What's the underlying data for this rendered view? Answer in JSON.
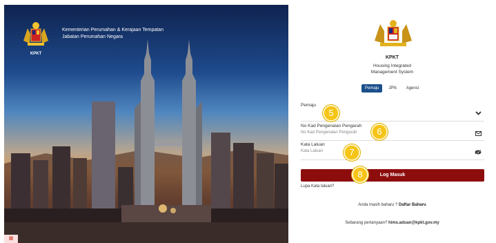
{
  "hero": {
    "ministry_line1": "Kementerian Perumahan & Kerajaan Tempatan",
    "ministry_line2": "Jabatan Perumahan Negara",
    "logo_text": "KPKT"
  },
  "brand": {
    "short": "KPKT",
    "line1": "Housing Integrated",
    "line2": "Management System"
  },
  "tabs": [
    {
      "label": "Pemaju",
      "active": true
    },
    {
      "label": "JPN",
      "active": false
    },
    {
      "label": "Agensi",
      "active": false
    }
  ],
  "form": {
    "developer": {
      "label": "Pemaju",
      "icon": "chevron-down-icon"
    },
    "ic": {
      "label": "No Kad Pengenalan Pengarah",
      "placeholder": "No Kad Pengenalan Pengarah",
      "icon": "mail-icon"
    },
    "password": {
      "label": "Kata Laluan",
      "placeholder": "Kata Laluan",
      "icon": "eye-slash-icon"
    },
    "login_label": "Log Masuk",
    "forgot_label": "Lupa Kata laluan?",
    "register_prompt": "Anda masih baharu ?",
    "register_link": "Daftar Baharu",
    "contact_prompt": "Sebarang pertanyaan?",
    "contact_email": "hims.aduan@kpkt.gov.my"
  },
  "markers": [
    "5",
    "6",
    "7",
    "8"
  ],
  "colors": {
    "primary_tab": "#1b4f8a",
    "login_button": "#8d0d0d",
    "marker": "#f6c416"
  }
}
